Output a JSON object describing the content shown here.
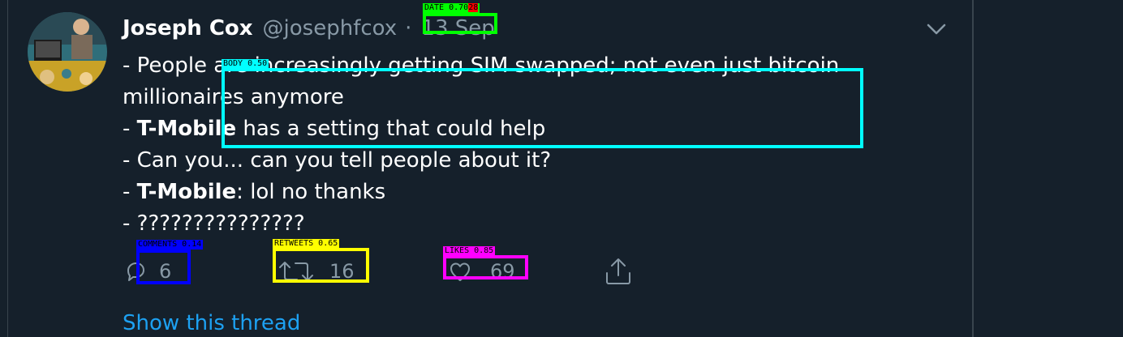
{
  "tweet": {
    "author_name": "Joseph Cox",
    "handle": "@josephfcox",
    "separator": "·",
    "date": "13 Sep",
    "body_lines": [
      {
        "prefix": "- ",
        "bold": "",
        "text": "People are increasingly getting SIM swapped; not even just bitcoin"
      },
      {
        "prefix": "",
        "bold": "",
        "text": "millionaires anymore"
      },
      {
        "prefix": "- ",
        "bold": "T-Mobile",
        "text": " has a setting that could help"
      },
      {
        "prefix": "- ",
        "bold": "",
        "text": "Can you... can you tell people about it?"
      },
      {
        "prefix": "- ",
        "bold": "T-Mobile",
        "text": ": lol no thanks"
      },
      {
        "prefix": "- ",
        "bold": "",
        "text": "???????????????"
      }
    ],
    "reply_count": "6",
    "retweet_count": "16",
    "like_count": "69",
    "show_thread": "Show this thread"
  },
  "annotations": {
    "date": {
      "label": "DATE 0.70",
      "extra": "28",
      "color": "#00ff00"
    },
    "body": {
      "label": "BODY 0.50",
      "color": "#00ffff"
    },
    "comments": {
      "label": "COMMENTS 0.14",
      "color": "#0000ff"
    },
    "retweets": {
      "label": "RETWEETS 0.65",
      "color": "#ffff00"
    },
    "likes": {
      "label": "LIKES 0.85",
      "color": "#ff00ff"
    }
  },
  "icons": {
    "chevron": "chevron-down-icon",
    "reply": "reply-icon",
    "retweet": "retweet-icon",
    "like": "heart-icon",
    "share": "share-icon"
  },
  "colors": {
    "background": "#15202b",
    "text_primary": "#ffffff",
    "text_secondary": "#8899a6",
    "link": "#1da1f2",
    "border": "#38444d"
  }
}
